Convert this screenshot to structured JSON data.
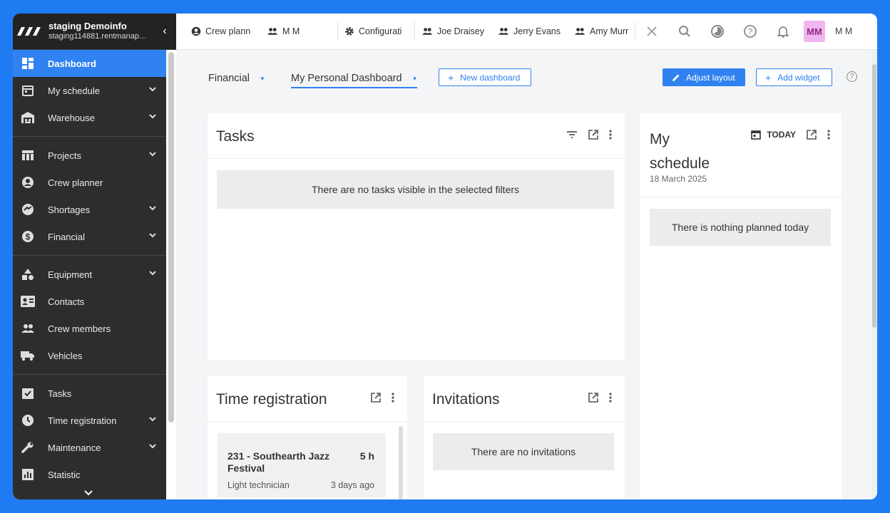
{
  "sidebar": {
    "org_name": "staging Demoinfo",
    "org_url": "staging114881.rentmanap…",
    "collapse_glyph": "‹",
    "items": [
      {
        "label": "Dashboard",
        "icon": "dashboard-icon",
        "active": true
      },
      {
        "label": "My schedule",
        "icon": "calendar-icon"
      },
      {
        "label": "Warehouse",
        "icon": "warehouse-icon"
      },
      {
        "label": "Projects",
        "icon": "projects-icon"
      },
      {
        "label": "Crew planner",
        "icon": "person-icon"
      },
      {
        "label": "Shortages",
        "icon": "shortages-icon"
      },
      {
        "label": "Financial",
        "icon": "dollar-icon"
      },
      {
        "label": "Equipment",
        "icon": "equipment-icon"
      },
      {
        "label": "Contacts",
        "icon": "contacts-icon"
      },
      {
        "label": "Crew members",
        "icon": "group-icon"
      },
      {
        "label": "Vehicles",
        "icon": "truck-icon"
      },
      {
        "label": "Tasks",
        "icon": "tasks-icon"
      },
      {
        "label": "Time registration",
        "icon": "clock-icon"
      },
      {
        "label": "Maintenance",
        "icon": "wrench-icon"
      },
      {
        "label": "Statistic",
        "icon": "chart-icon"
      }
    ]
  },
  "topbar": {
    "tabs": [
      {
        "label": "Crew plann",
        "icon": "person-circle-icon"
      },
      {
        "label": "M M",
        "icon": "group-icon"
      },
      {
        "label": "Configurati",
        "icon": "gear-icon"
      },
      {
        "label": "Joe Draisey",
        "icon": "group-icon"
      },
      {
        "label": "Jerry Evans",
        "icon": "group-icon"
      },
      {
        "label": "Amy Murray",
        "icon": "group-icon"
      }
    ],
    "avatar_initials": "MM",
    "user_name": "M M"
  },
  "dashboard_bar": {
    "selector_1": "Financial",
    "selector_2": "My Personal Dashboard",
    "new_dashboard": "New dashboard",
    "adjust_layout": "Adjust layout",
    "add_widget": "Add widget",
    "help": "?"
  },
  "widgets": {
    "tasks": {
      "title": "Tasks",
      "empty": "There are no tasks visible in the selected filters"
    },
    "schedule": {
      "title_line1": "My",
      "title_line2": "schedule",
      "date": "18 March 2025",
      "today": "TODAY",
      "empty": "There is nothing planned today"
    },
    "time_registration": {
      "title": "Time registration",
      "item": {
        "title": "231 - Southearth Jazz Festival",
        "hours": "5 h",
        "role": "Light technician",
        "when": "3 days ago"
      }
    },
    "invitations": {
      "title": "Invitations",
      "empty": "There are no invitations"
    }
  },
  "colors": {
    "accent": "#2f82f0",
    "sidebar_bg": "#2d2d2d",
    "avatar_bg": "#f2b6ee"
  }
}
